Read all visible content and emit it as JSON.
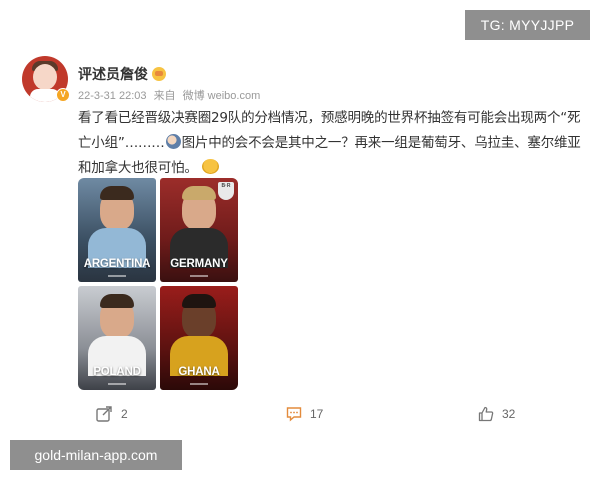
{
  "watermarks": {
    "top_right": "TG: MYYJJPP",
    "bottom_left": "gold-milan-app.com"
  },
  "post": {
    "username": "评述员詹俊",
    "meta": {
      "date": "22-3-31 22:03",
      "source_prefix": "来自",
      "source": "微博 weibo.com"
    },
    "text_part1": "看了看已经晋级决赛圈29队的分档情况，预感明晚的世界杯抽签有可能会出现两个“死亡小组”………",
    "text_part2": "图片中的会不会是其中之一？再来一组是葡萄牙、乌拉圭、塞尔维亚和加拿大也很可怕。",
    "images": [
      {
        "country": "ARGENTINA"
      },
      {
        "country": "GERMANY"
      },
      {
        "country": "POLAND"
      },
      {
        "country": "GHANA"
      }
    ],
    "germany_crest": "B·R",
    "actions": {
      "share_count": "2",
      "comment_count": "17",
      "like_count": "32"
    }
  },
  "icons": {
    "share": "share-icon",
    "comment": "comment-icon",
    "like": "thumbs-up-icon",
    "verified": "verified-badge-icon",
    "crown": "crown-icon"
  }
}
